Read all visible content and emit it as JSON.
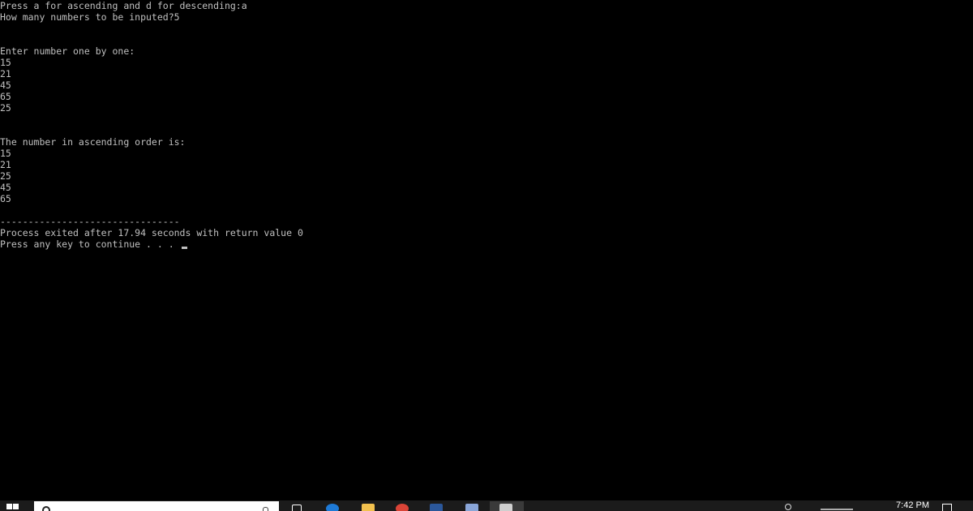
{
  "console": {
    "lines": [
      "Press a for ascending and d for descending:a",
      "How many numbers to be inputed?5",
      "",
      "",
      "Enter number one by one:",
      "15",
      "21",
      "45",
      "65",
      "25",
      "",
      "",
      "The number in ascending order is:",
      "15",
      "21",
      "25",
      "45",
      "65",
      "",
      "--------------------------------",
      "Process exited after 17.94 seconds with return value 0",
      "Press any key to continue . . . "
    ],
    "text_color": "#c0c0c0",
    "background": "#000000"
  },
  "taskbar": {
    "clock_time": "7:42 PM",
    "apps": [
      {
        "name": "task-view-icon",
        "color": "#ffffff"
      },
      {
        "name": "edge-icon",
        "color": "#1e7ad6"
      },
      {
        "name": "file-explorer-icon",
        "color": "#f2c14e"
      },
      {
        "name": "chrome-icon",
        "color": "#db4437"
      },
      {
        "name": "word-icon",
        "color": "#2b579a"
      },
      {
        "name": "app-icon",
        "color": "#8aa6d8"
      },
      {
        "name": "console-app-icon",
        "color": "#cfcfcf"
      }
    ]
  }
}
